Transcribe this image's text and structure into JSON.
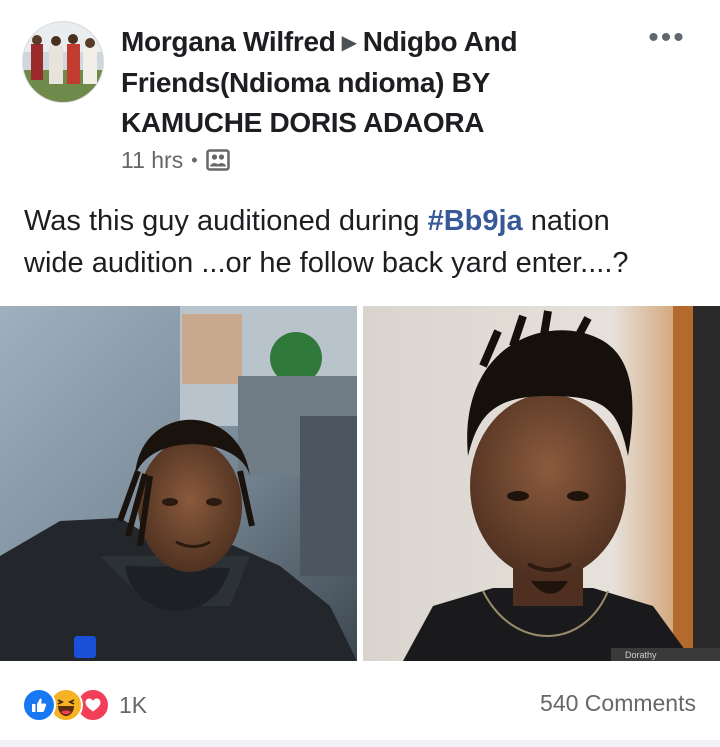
{
  "post": {
    "author": "Morgana Wilfred",
    "separator_icon": "right-triangle-icon",
    "group_line1": "Ndigbo And",
    "group_line2": "Friends(Ndioma ndioma) BY",
    "group_line3": "KAMUCHE DORIS ADAORA",
    "time": "11 hrs",
    "dot": "•",
    "audience_icon": "group-photo-icon",
    "more_label": "•••",
    "text_before": "Was this guy auditioned during ",
    "hashtag": "#Bb9ja",
    "text_after_1": "  nation",
    "text_line2": "wide audition ...or he follow back yard enter....?"
  },
  "photos": {
    "left_caption": "",
    "right_watermark": "Dorathy"
  },
  "footer": {
    "reaction_icons": [
      "like-icon",
      "haha-icon",
      "love-icon"
    ],
    "reaction_count": "1K",
    "comments": "540 Comments"
  },
  "colors": {
    "hashtag": "#385898",
    "like": "#1877f2",
    "haha": "#f7b125",
    "love": "#f33e58",
    "meta": "#65676b"
  }
}
